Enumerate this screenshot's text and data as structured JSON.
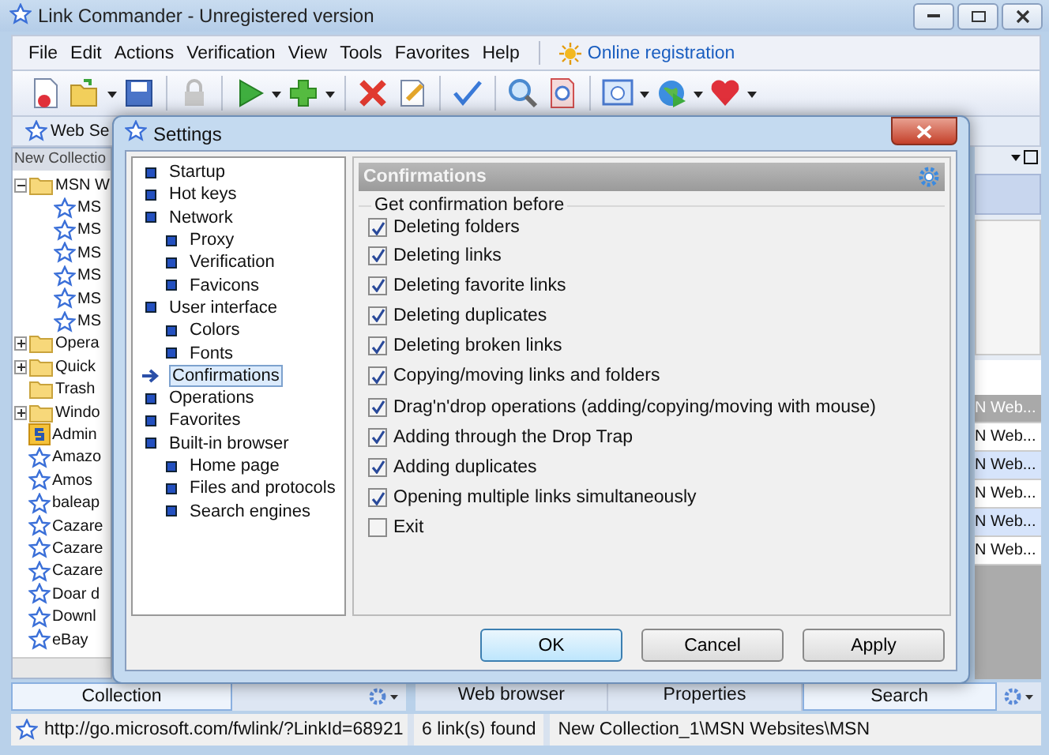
{
  "window": {
    "title": "Link Commander - Unregistered version"
  },
  "menu": {
    "items": [
      "File",
      "Edit",
      "Actions",
      "Verification",
      "View",
      "Tools",
      "Favorites",
      "Help"
    ],
    "registration": "Online registration"
  },
  "links_bar": {
    "label": "Web Se"
  },
  "collection": {
    "header": "New Collectio",
    "tree": [
      {
        "label": "MSN W",
        "kind": "folder",
        "expanded": true,
        "children": [
          {
            "label": "MS",
            "kind": "link"
          },
          {
            "label": "MS",
            "kind": "link"
          },
          {
            "label": "MS",
            "kind": "link"
          },
          {
            "label": "MS",
            "kind": "link"
          },
          {
            "label": "MS",
            "kind": "link"
          },
          {
            "label": "MS",
            "kind": "link"
          }
        ]
      },
      {
        "label": "Opera",
        "kind": "folder",
        "expanded": false
      },
      {
        "label": "Quick",
        "kind": "folder",
        "expanded": false
      },
      {
        "label": "Trash",
        "kind": "folder"
      },
      {
        "label": "Windo",
        "kind": "folder",
        "expanded": false
      },
      {
        "label": "Admin",
        "kind": "special"
      },
      {
        "label": "Amazo",
        "kind": "link"
      },
      {
        "label": "Amos",
        "kind": "link"
      },
      {
        "label": "baleap",
        "kind": "link"
      },
      {
        "label": "Cazare",
        "kind": "link"
      },
      {
        "label": "Cazare",
        "kind": "link"
      },
      {
        "label": "Cazare",
        "kind": "link"
      },
      {
        "label": "Doar d",
        "kind": "link"
      },
      {
        "label": "Downl",
        "kind": "link"
      },
      {
        "label": "eBay",
        "kind": "link"
      }
    ]
  },
  "results": [
    {
      "text": "N Web...",
      "selected": true
    },
    {
      "text": "N Web...",
      "selected": false
    },
    {
      "text": "N Web...",
      "selected": false
    },
    {
      "text": "N Web...",
      "selected": false
    },
    {
      "text": "N Web...",
      "selected": false
    },
    {
      "text": "N Web...",
      "selected": false
    }
  ],
  "bottom_tabs_left": [
    {
      "label": "Collection",
      "selected": true
    }
  ],
  "bottom_tabs_right": [
    {
      "label": "Web browser",
      "selected": false
    },
    {
      "label": "Properties",
      "selected": false
    },
    {
      "label": "Search",
      "selected": true
    }
  ],
  "status_bar": {
    "url": "http://go.microsoft.com/fwlink/?LinkId=68921",
    "count": "6 link(s) found",
    "path": "New Collection_1\\MSN Websites\\MSN"
  },
  "settings": {
    "title": "Settings",
    "nav": [
      {
        "label": "Startup",
        "selected": false
      },
      {
        "label": "Hot keys",
        "selected": false
      },
      {
        "label": "Network",
        "selected": false,
        "children": [
          {
            "label": "Proxy",
            "selected": false
          },
          {
            "label": "Verification",
            "selected": false
          },
          {
            "label": "Favicons",
            "selected": false
          }
        ]
      },
      {
        "label": "User interface",
        "selected": false,
        "children": [
          {
            "label": "Colors",
            "selected": false
          },
          {
            "label": "Fonts",
            "selected": false
          }
        ]
      },
      {
        "label": "Confirmations",
        "selected": true
      },
      {
        "label": "Operations",
        "selected": false
      },
      {
        "label": "Favorites",
        "selected": false
      },
      {
        "label": "Built-in browser",
        "selected": false,
        "children": [
          {
            "label": "Home page",
            "selected": false
          },
          {
            "label": "Files and protocols",
            "selected": false
          },
          {
            "label": "Search engines",
            "selected": false
          }
        ]
      }
    ],
    "section_title": "Confirmations",
    "group_label": "Get confirmation before",
    "options": [
      {
        "label": "Deleting folders",
        "checked": true
      },
      {
        "label": "Deleting links",
        "checked": true
      },
      {
        "label": "Deleting favorite links",
        "checked": true
      },
      {
        "label": "Deleting duplicates",
        "checked": true
      },
      {
        "label": "Deleting broken links",
        "checked": true
      },
      {
        "label": "Copying/moving links and folders",
        "checked": true
      },
      {
        "label": "Drag'n'drop operations (adding/copying/moving with mouse)",
        "checked": true
      },
      {
        "label": "Adding through the Drop Trap",
        "checked": true
      },
      {
        "label": "Adding duplicates",
        "checked": true
      },
      {
        "label": "Opening multiple links simultaneously",
        "checked": true
      },
      {
        "label": "Exit",
        "checked": false
      }
    ],
    "buttons": [
      "OK",
      "Cancel",
      "Apply"
    ]
  }
}
